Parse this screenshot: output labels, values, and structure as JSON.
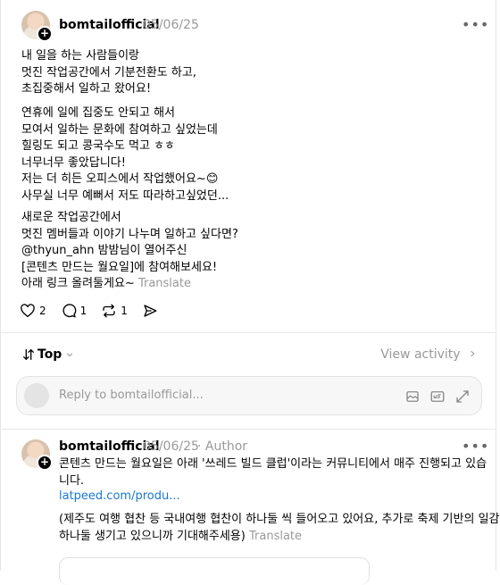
{
  "post": {
    "username": "bomtailofficial",
    "date": "05/06/25",
    "paragraphs": [
      [
        "내 일을 하는 사람들이랑",
        "멋진 작업공간에서 기분전환도 하고,",
        "초집중해서 일하고 왔어요!"
      ],
      [
        "연휴에 일에 집중도 안되고 해서",
        "모여서 일하는 문화에 참여하고 싶었는데",
        "힐링도 되고 콩국수도 먹고 ㅎㅎ",
        "너무너무 좋았답니다!",
        "저는 더 히든 오피스에서 작업했어요~😊",
        "사무실 너무 예뻐서 저도 따라하고싶었던..."
      ],
      [
        "새로운 작업공간에서",
        "멋진 멤버들과 이야기 나누며 일하고 싶다면?",
        "@thyun_ahn 밤밤님이 열어주신",
        "[콘텐츠 만드는 월요일]에 참여해보세요!",
        "아래 링크 올려둘게요~"
      ]
    ],
    "translate": "Translate",
    "likes": "2",
    "comments": "1",
    "reposts": "1",
    "more": "•••"
  },
  "sort": {
    "label": "Top",
    "view_activity": "View activity"
  },
  "reply_box": {
    "placeholder": "Reply to bomtailofficial..."
  },
  "comment": {
    "username": "bomtailofficial",
    "date": "05/06/25",
    "author_badge": "· Author",
    "lines": [
      "콘텐츠 만드는 월요일은 아래 '쓰레드 빌드 클럽'이라는 커뮤니티에서 매주 진행되고 있습",
      "니다."
    ],
    "link": "latpeed.com/produ...",
    "lines2": [
      "(제주도 여행 협찬 등 국내여행 협찬이 하나둘 씩 들어오고 있어요, 추가로 축제 기반의 일감도",
      "하나둘 생기고 있으니까 기대해주세용)"
    ],
    "translate": "Translate",
    "more": "•••"
  },
  "icons": [
    "heart-icon",
    "comment-icon",
    "repost-icon",
    "share-icon",
    "sort-icon",
    "chevron-down-icon",
    "chevron-right-icon",
    "image-icon",
    "gif-icon",
    "expand-icon",
    "more-icon"
  ]
}
